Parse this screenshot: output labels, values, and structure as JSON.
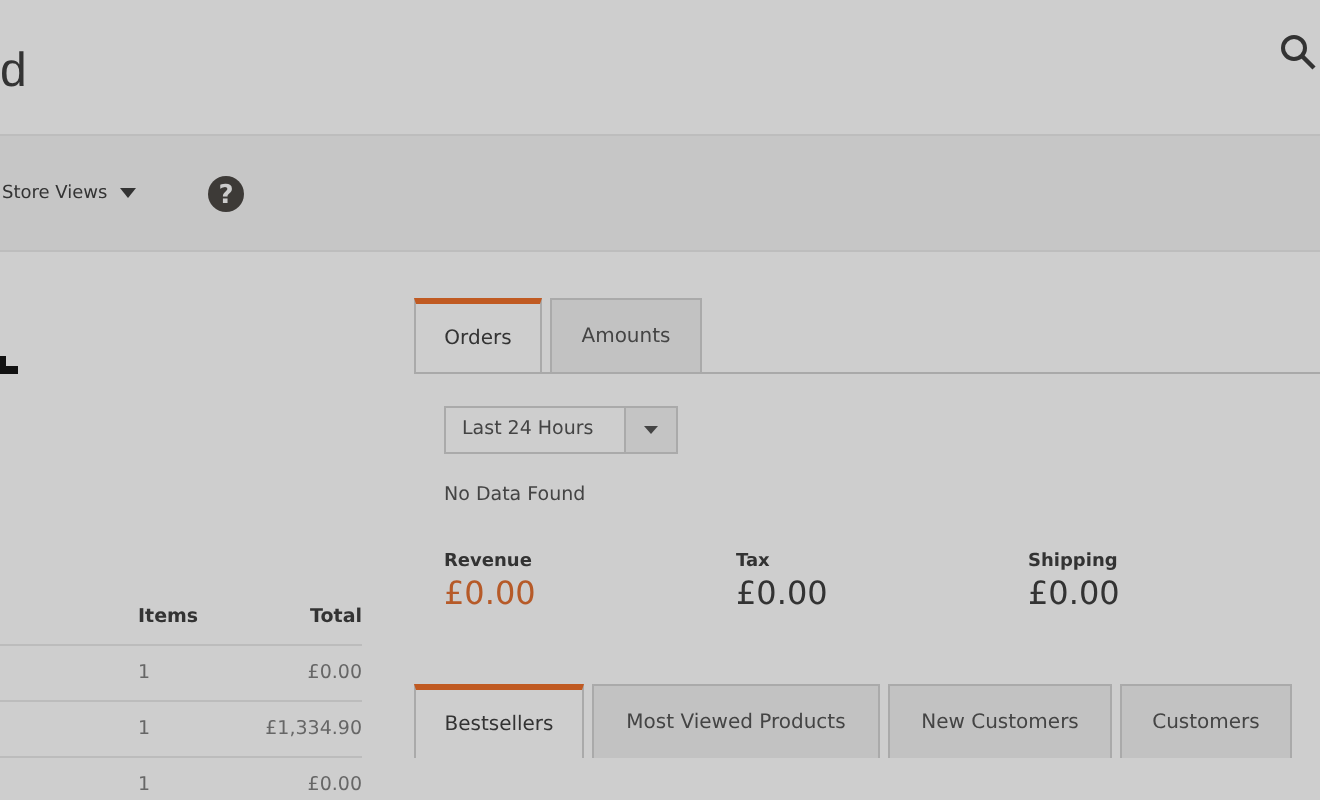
{
  "header": {
    "title": "d"
  },
  "toolbar": {
    "scope": "Store Views",
    "help": "?"
  },
  "last_orders": {
    "columns": [
      "Items",
      "Total"
    ],
    "rows": [
      {
        "items": "1",
        "total": "£0.00"
      },
      {
        "items": "1",
        "total": "£1,334.90"
      },
      {
        "items": "1",
        "total": "£0.00"
      }
    ]
  },
  "chart_tabs": [
    {
      "label": "Orders",
      "selected": true
    },
    {
      "label": "Amounts",
      "selected": false
    }
  ],
  "period": {
    "value": "Last 24 Hours"
  },
  "message": "No Data Found",
  "totals": [
    {
      "label": "Revenue",
      "value": "£0.00",
      "kind": "highlight"
    },
    {
      "label": "Tax",
      "value": "£0.00",
      "kind": "plain"
    },
    {
      "label": "Shipping",
      "value": "£0.00",
      "kind": "plain"
    }
  ],
  "grid_tabs": [
    {
      "label": "Bestsellers",
      "selected": true
    },
    {
      "label": "Most Viewed Products",
      "selected": false
    },
    {
      "label": "New Customers",
      "selected": false
    },
    {
      "label": "Customers",
      "selected": false
    }
  ]
}
